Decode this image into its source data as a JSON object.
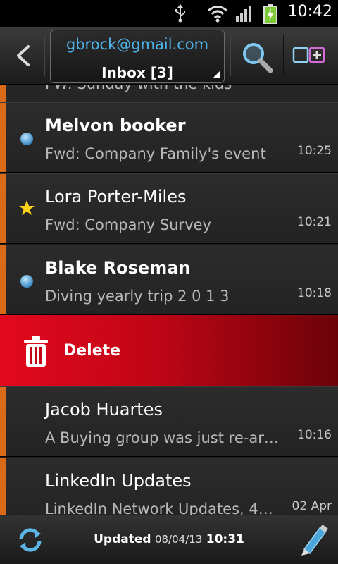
{
  "status_bar": {
    "time": "10:42",
    "icons": [
      "usb-icon",
      "wifi-icon",
      "signal-icon",
      "battery-charging-icon"
    ]
  },
  "toolbar": {
    "account_email": "gbrock@gmail.com",
    "folder_label": "Inbox [3]",
    "icons": [
      "back-arrow-icon",
      "search-icon",
      "multi-select-icon"
    ]
  },
  "partial_row": {
    "text": "FW: Sunday with the kids"
  },
  "messages": [
    {
      "sender": "Melvon booker",
      "subject": "Fwd: Company Family's event",
      "time": "10:25",
      "unread": true,
      "starred": false
    },
    {
      "sender": "Lora Porter-Miles",
      "subject": "Fwd: Company Survey",
      "time": "10:21",
      "unread": false,
      "starred": true
    },
    {
      "sender": "Blake Roseman",
      "subject": "Diving yearly trip 2 0 1 3",
      "time": "10:18",
      "unread": true,
      "starred": false
    },
    {
      "sender": "Jacob Huartes",
      "subject": "A Buying group was just re-ar…",
      "time": "10:16",
      "unread": false,
      "starred": false
    },
    {
      "sender": "LinkedIn Updates",
      "subject": "LinkedIn Network Updates, 4…",
      "time": "02 Apr",
      "unread": false,
      "starred": false
    }
  ],
  "swipe_action": {
    "label": "Delete",
    "icon": "trash-icon",
    "color": "#e3081e"
  },
  "bottom_bar": {
    "updated_label": "Updated",
    "updated_date": "08/04/13",
    "updated_time": "10:31",
    "icons": [
      "sync-icon",
      "compose-pen-icon"
    ]
  },
  "colors": {
    "accent_bar": "#d86a18",
    "email_blue": "#4fb3e8",
    "delete_red": "#e3081e"
  }
}
